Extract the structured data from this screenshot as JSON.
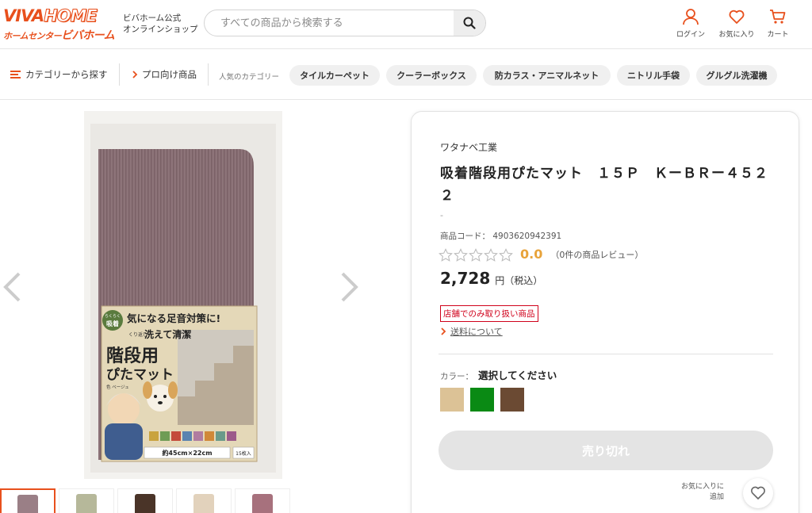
{
  "brand_colors": {
    "accent": "#e8501d",
    "price_star": "#e8a33a",
    "red": "#d0021b"
  },
  "header": {
    "logo_viva": "VIVA",
    "logo_home": "HOME",
    "logo_small": "ホームセンター",
    "logo_big": "ビバホーム",
    "shop_line1": "ビバホーム公式",
    "shop_line2": "オンラインショップ",
    "search_placeholder": "すべての商品から検索する",
    "login": "ログイン",
    "favorites": "お気に入り",
    "cart": "カート"
  },
  "nav": {
    "category": "カテゴリーから探す",
    "pro": "プロ向け商品",
    "popular_label": "人気のカテゴリー",
    "chips": [
      "タイルカーペット",
      "クーラーボックス",
      "防カラス・アニマルネット",
      "ニトリル手袋",
      "グルグル洗濯機"
    ]
  },
  "gallery": {
    "thumb_colors": [
      "#9a7f86",
      "#b6b89a",
      "#4a3428",
      "#e2d2bc",
      "#a7717d"
    ],
    "package_texts": {
      "badge_top": "らくらく",
      "badge_bottom": "吸着",
      "headline": "気になる足音対策に!",
      "sub_small": "くり返し",
      "sub": "洗えて清潔",
      "product_line1": "階段用",
      "product_line2": "ぴたマット",
      "color_note": "色 ベージュ",
      "size": "約45cm×22cm",
      "count": "15枚入"
    }
  },
  "product": {
    "brand": "ワタナベ工業",
    "title": "吸着階段用ぴたマット　１５Ｐ　ＫーＢＲー４５２２",
    "dash": "-",
    "code_label": "商品コード：",
    "code": "4903620942391",
    "rating": "0.0",
    "stars": 0,
    "review_count": "（0件の商品レビュー）",
    "price": "2,728",
    "price_unit": "円（税込）",
    "store_only": "店舗でのみ取り扱い商品",
    "shipping": "送料について",
    "color_label": "カラー：",
    "color_prompt": "選択してください",
    "swatches": [
      "#dcc296",
      "#0a8a14",
      "#6b4a33"
    ],
    "soldout": "売り切れ",
    "fav_line1": "お気に入りに",
    "fav_line2": "追加"
  }
}
